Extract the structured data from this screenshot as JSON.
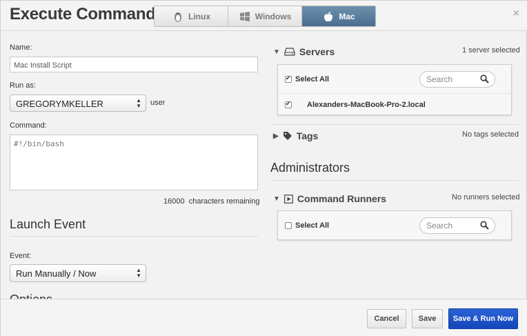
{
  "dialog": {
    "title": "Execute Command",
    "close": "×"
  },
  "os_tabs": [
    {
      "label": "Linux",
      "icon": "linux-penguin-icon"
    },
    {
      "label": "Windows",
      "icon": "windows-logo-icon"
    },
    {
      "label": "Mac",
      "icon": "apple-logo-icon",
      "active": true
    }
  ],
  "form": {
    "name_label": "Name:",
    "name_value": "Mac Install Script",
    "run_as_label": "Run as:",
    "run_as_value": "GREGORYMKELLER",
    "run_as_suffix": "user",
    "command_label": "Command:",
    "command_value": "#!/bin/bash",
    "chars_count": "16000",
    "chars_text": "characters remaining"
  },
  "launch_event": {
    "title": "Launch Event",
    "event_label": "Event:",
    "event_value": "Run Manually / Now",
    "next_section_partial": "Options"
  },
  "servers": {
    "title": "Servers",
    "selected_note": "1 server selected",
    "select_all": "Select All",
    "search_placeholder": "Search",
    "items": [
      {
        "name": "Alexanders-MacBook-Pro-2.local",
        "checked": true
      }
    ]
  },
  "tags": {
    "title": "Tags",
    "selected_note": "No tags selected"
  },
  "administrators": {
    "title": "Administrators"
  },
  "command_runners": {
    "title": "Command Runners",
    "selected_note": "No runners selected",
    "select_all": "Select All",
    "search_placeholder": "Search"
  },
  "footer": {
    "cancel": "Cancel",
    "save": "Save",
    "save_run": "Save & Run Now"
  },
  "colors": {
    "primary_button": "#1a4fc4",
    "active_tab": "#5a7d9c"
  }
}
